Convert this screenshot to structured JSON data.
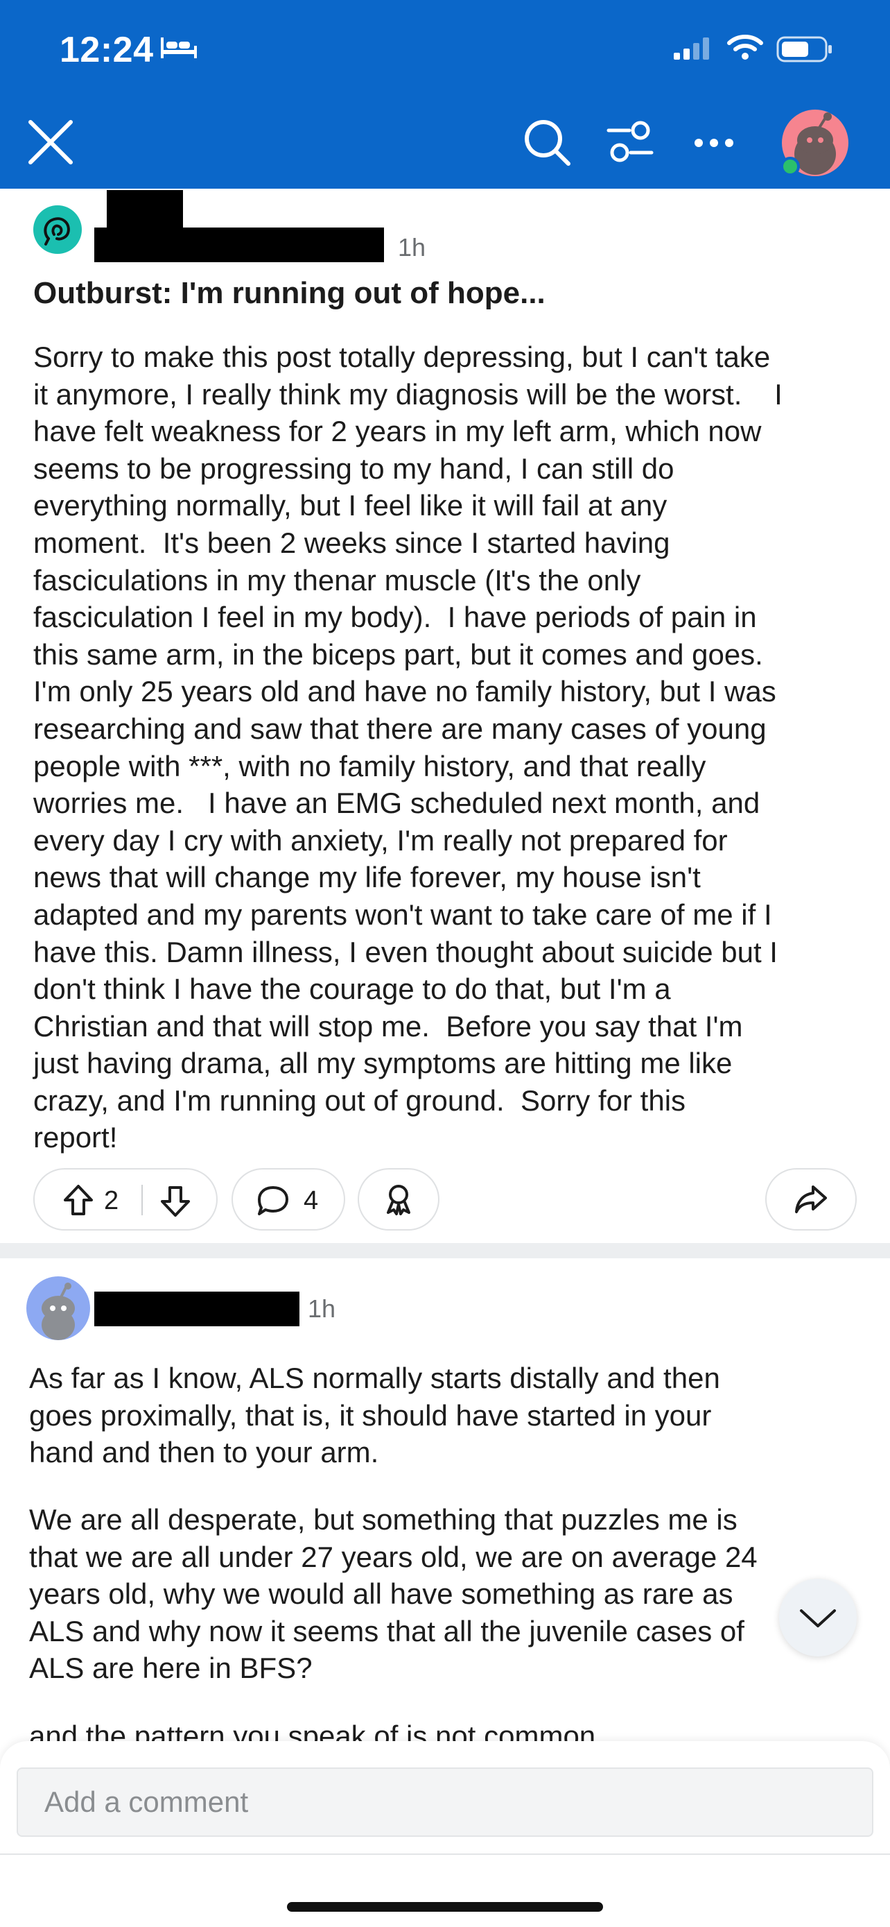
{
  "status_bar": {
    "time": "12:24"
  },
  "post": {
    "age": "1h",
    "title": "Outburst: I'm running out of hope...",
    "body": "Sorry to make this post totally depressing, but I can't take\nit anymore, I really think my diagnosis will be the worst.    I\nhave felt weakness for 2 years in my left arm, which now\nseems to be progressing to my hand, I can still do\neverything normally, but I feel like it will fail at any\nmoment.  It's been 2 weeks since I started having\nfasciculations in my thenar muscle (It's the only\nfasciculation I feel in my body).  I have periods of pain in\nthis same arm, in the biceps part, but it comes and goes.\nI'm only 25 years old and have no family history, but I was\nresearching and saw that there are many cases of young\npeople with ***, with no family history, and that really\nworries me.   I have an EMG scheduled next month, and\nevery day I cry with anxiety, I'm really not prepared for\nnews that will change my life forever, my house isn't\nadapted and my parents won't want to take care of me if I\nhave this. Damn illness, I even thought about suicide but I\ndon't think I have the courage to do that, but I'm a\nChristian and that will stop me.  Before you say that I'm\njust having drama, all my symptoms are hitting me like\ncrazy, and I'm running out of ground.  Sorry for this\nreport!",
    "votes": "2",
    "comments": "4"
  },
  "comment": {
    "age": "1h",
    "paragraph1": "As far as I know, ALS normally starts distally and then\ngoes proximally, that is, it should have started in your\nhand and then to your arm.",
    "paragraph2": "We are all desperate, but something that puzzles me is\nthat we are all under 27 years old, we are on average 24\nyears old, why we would all have something as rare as\nALS and why now it seems that all the juvenile cases of\nALS are here in BFS?",
    "paragraph3": "and the pattern you speak of is not common."
  },
  "composer": {
    "placeholder": "Add a comment"
  },
  "icons": {
    "close": "close-icon",
    "search": "search-icon",
    "filter": "filter-icon",
    "more": "more-icon",
    "upvote": "upvote-icon",
    "downvote": "downvote-icon",
    "comment": "comment-icon",
    "award": "award-icon",
    "share": "share-icon",
    "scroll_down": "chevron-down-icon"
  },
  "colors": {
    "header": "#0b67c9",
    "community_avatar": "#1bbfb0",
    "user_avatar": "#f6848f",
    "online": "#2bc06c"
  }
}
